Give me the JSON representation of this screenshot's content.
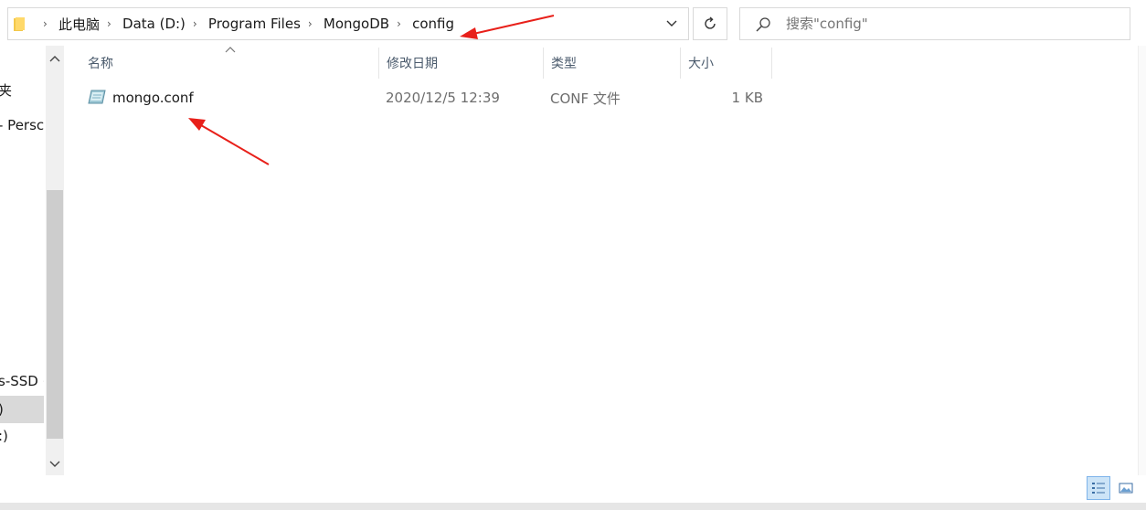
{
  "address_bar": {
    "breadcrumbs": [
      "此电脑",
      "Data (D:)",
      "Program Files",
      "MongoDB",
      "config"
    ],
    "separator_icon": "chevron-right-icon",
    "dropdown_icon": "chevron-down-icon"
  },
  "refresh_icon": "refresh-icon",
  "search": {
    "placeholder": "搜索\"config\"",
    "icon": "search-icon"
  },
  "nav_pane": {
    "items": [
      {
        "label": "夹"
      },
      {
        "label": "- Persc"
      },
      {
        "label": "s-SSD ("
      },
      {
        "label": ")"
      },
      {
        "label": ":)"
      }
    ],
    "selected_label": ")"
  },
  "columns": {
    "name": "名称",
    "date_modified": "修改日期",
    "type": "类型",
    "size": "大小"
  },
  "files": [
    {
      "name": "mongo.conf",
      "date_modified": "2020/12/5 12:39",
      "type": "CONF 文件",
      "size": "1 KB",
      "icon": "conf-file-icon"
    }
  ],
  "view_buttons": {
    "details_icon": "details-view-icon",
    "tiles_icon": "large-icons-view-icon"
  },
  "colors": {
    "annotation_arrow": "#e8201a",
    "header_text": "#4a5a6c",
    "selected_view_bg": "#cce4f7"
  }
}
